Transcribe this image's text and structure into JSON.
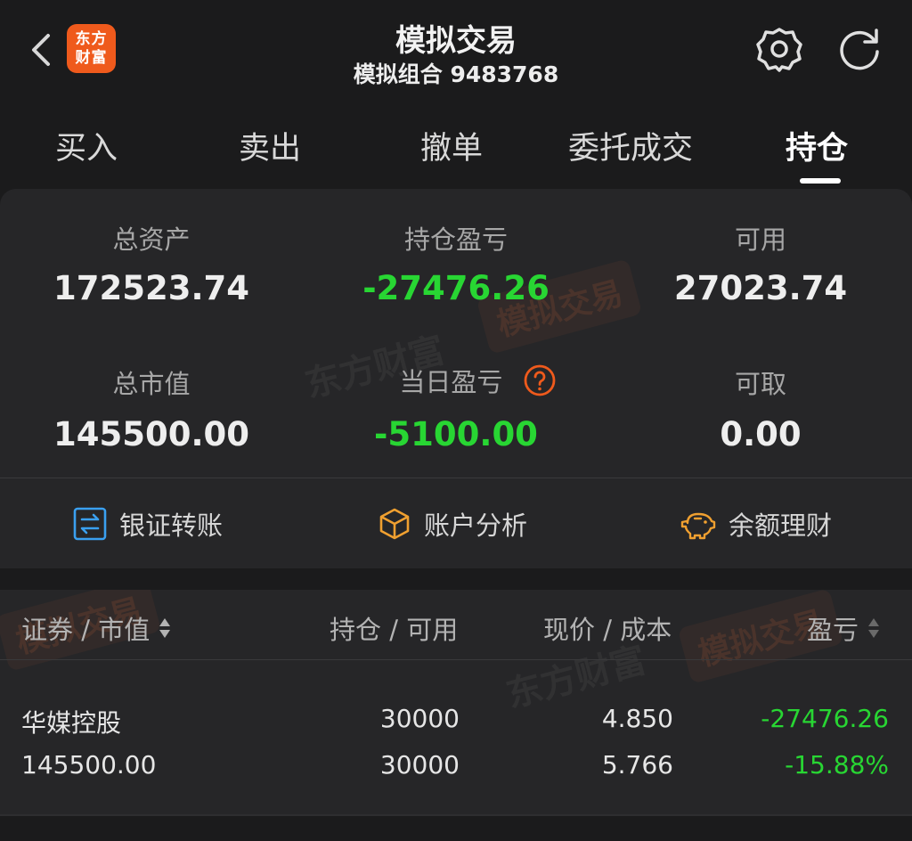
{
  "header": {
    "title": "模拟交易",
    "subtitle": "模拟组合 9483768",
    "logo_line1": "东方",
    "logo_line2": "财富"
  },
  "tabs": [
    {
      "label": "买入"
    },
    {
      "label": "卖出"
    },
    {
      "label": "撤单"
    },
    {
      "label": "委托成交"
    },
    {
      "label": "持仓",
      "active": true
    }
  ],
  "summary": {
    "total_assets_label": "总资产",
    "total_assets_value": "172523.74",
    "position_pl_label": "持仓盈亏",
    "position_pl_value": "-27476.26",
    "available_label": "可用",
    "available_value": "27023.74",
    "market_value_label": "总市值",
    "market_value_value": "145500.00",
    "daily_pl_label": "当日盈亏",
    "daily_pl_value": "-5100.00",
    "withdrawable_label": "可取",
    "withdrawable_value": "0.00"
  },
  "actions": {
    "bank_transfer": "银证转账",
    "account_analysis": "账户分析",
    "balance_finance": "余额理财"
  },
  "watermark": {
    "brand": "东方财富",
    "mode": "模拟交易"
  },
  "table": {
    "headers": {
      "security": "证券 / 市值",
      "position": "持仓 / 可用",
      "price": "现价 / 成本",
      "pl": "盈亏"
    },
    "rows": [
      {
        "name": "华媒控股",
        "market_value": "145500.00",
        "position": "30000",
        "available": "30000",
        "current_price": "4.850",
        "cost": "5.766",
        "pl": "-27476.26",
        "pl_pct": "-15.88%"
      }
    ]
  },
  "colors": {
    "loss_green": "#28d633",
    "accent_orange": "#ef5a1c",
    "icon_blue": "#3aa0f0",
    "icon_orange": "#f0a030"
  }
}
